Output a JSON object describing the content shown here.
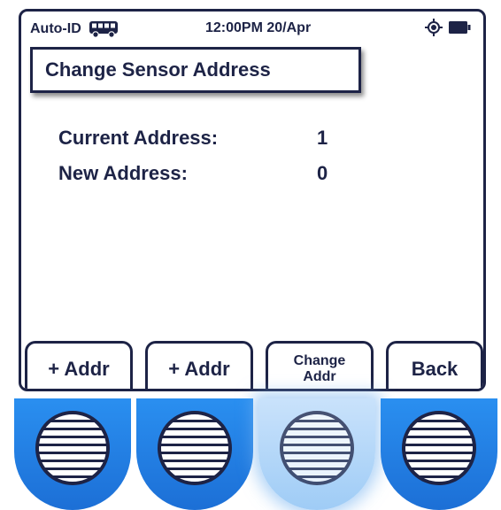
{
  "status": {
    "mode": "Auto-ID",
    "time_date": "12:00PM 20/Apr",
    "icons": [
      "bus-icon",
      "gps-icon",
      "battery-icon"
    ]
  },
  "title": "Change Sensor Address",
  "info": {
    "current_label": "Current Address:",
    "current_value": "1",
    "new_label": "New Address:",
    "new_value": "0"
  },
  "softkeys": [
    {
      "label": "+ Addr"
    },
    {
      "label": "+ Addr"
    },
    {
      "label_line1": "Change",
      "label_line2": "Addr"
    },
    {
      "label": "Back"
    }
  ],
  "colors": {
    "ink": "#1d2346",
    "hw_key": "#1c6fd6",
    "hw_key_pressed": "#c9e2fb"
  }
}
